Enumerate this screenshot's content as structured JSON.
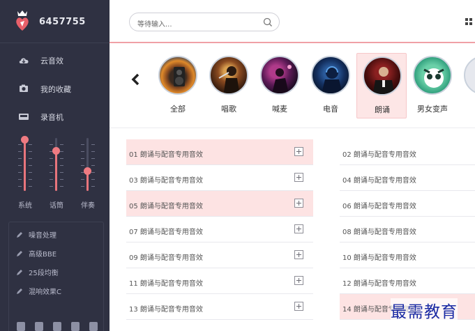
{
  "brand": {
    "name": "6457755",
    "logo_icon": "crowned-heart-logo"
  },
  "sidebar": {
    "nav": [
      {
        "label": "云音效",
        "icon": "cloud-icon"
      },
      {
        "label": "我的收藏",
        "icon": "camera-icon"
      },
      {
        "label": "录音机",
        "icon": "recorder-icon"
      }
    ],
    "mixer": [
      {
        "label": "系统",
        "level": 0.97
      },
      {
        "label": "话筒",
        "level": 0.76
      },
      {
        "label": "伴奏",
        "level": 0.38
      }
    ],
    "effects": [
      {
        "label": "噪音处理",
        "icon": "pencil-icon"
      },
      {
        "label": "高级BBE",
        "icon": "pencil-icon"
      },
      {
        "label": "25段均衡",
        "icon": "pencil-icon"
      },
      {
        "label": "混响效果C",
        "icon": "pencil-icon"
      }
    ]
  },
  "search": {
    "placeholder": "等待输入...",
    "icon": "search-icon"
  },
  "header": {
    "menu_icon": "grid-icon"
  },
  "categories": {
    "prev_icon": "chevron-left-icon",
    "items": [
      {
        "label": "全部",
        "active": false
      },
      {
        "label": "唱歌",
        "active": false
      },
      {
        "label": "喊麦",
        "active": false
      },
      {
        "label": "电音",
        "active": false
      },
      {
        "label": "朗诵",
        "active": true
      },
      {
        "label": "男女变声",
        "active": false
      }
    ]
  },
  "sounds": {
    "left": [
      {
        "title": "01 朗诵与配音专用音效",
        "highlighted": true
      },
      {
        "title": "03 朗诵与配音专用音效",
        "highlighted": false
      },
      {
        "title": "05 朗诵与配音专用音效",
        "highlighted": true
      },
      {
        "title": "07 朗诵与配音专用音效",
        "highlighted": false
      },
      {
        "title": "09 朗诵与配音专用音效",
        "highlighted": false
      },
      {
        "title": "11 朗诵与配音专用音效",
        "highlighted": false
      },
      {
        "title": "13 朗诵与配音专用音效",
        "highlighted": false
      }
    ],
    "right": [
      {
        "title": "02 朗诵与配音专用音效",
        "highlighted": false
      },
      {
        "title": "04 朗诵与配音专用音效",
        "highlighted": false
      },
      {
        "title": "06 朗诵与配音专用音效",
        "highlighted": false
      },
      {
        "title": "08 朗诵与配音专用音效",
        "highlighted": false
      },
      {
        "title": "10 朗诵与配音专用音效",
        "highlighted": false
      },
      {
        "title": "12 朗诵与配音专用音效",
        "highlighted": false
      },
      {
        "title": "14 朗诵与配音专用音效",
        "highlighted": true
      }
    ]
  },
  "watermark": "最需教育",
  "colors": {
    "accent": "#ef7b82",
    "sidebar_bg": "#2f3142",
    "highlight_bg": "#fde3e3",
    "watermark": "#1a2aa3"
  }
}
